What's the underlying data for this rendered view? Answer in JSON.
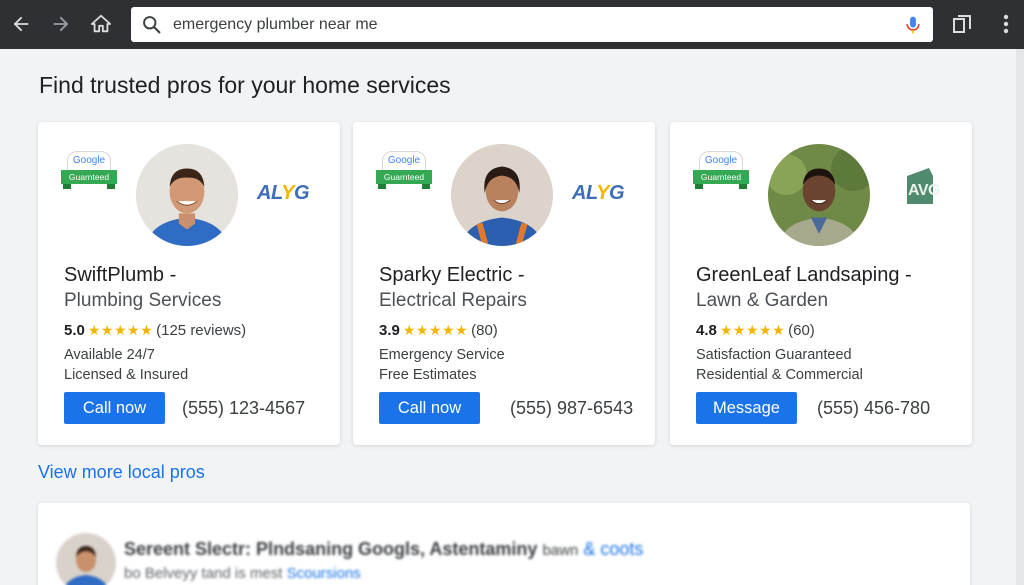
{
  "browser": {
    "search_query": "emergency plumber near me"
  },
  "heading": "Find trusted pros for your home services",
  "cards": [
    {
      "badge_top": "Google",
      "badge_bottom": "Guarnteed",
      "brand": "ALYG",
      "name": "SwiftPlumb -",
      "subtitle": "Plumbing Services",
      "rating": "5.0",
      "stars": "★★★★★",
      "reviews": "(125 reviews)",
      "line1": "Available 24/7",
      "line2": "Licensed & Insured",
      "action": "Call now",
      "phone": "(555) 123-4567"
    },
    {
      "badge_top": "Google",
      "badge_bottom": "Guarnteed",
      "brand": "ALYG",
      "name": "Sparky Electric -",
      "subtitle": "Electrical Repairs",
      "rating": "3.9",
      "stars": "★★★★★",
      "reviews": "(80)",
      "line1": "Emergency Service",
      "line2": "Free Estimates",
      "action": "Call now",
      "phone": "(555) 987-6543"
    },
    {
      "badge_top": "Google",
      "badge_bottom": "Guarnteed",
      "brand": "AVG",
      "name": "GreenLeaf Landsaping -",
      "subtitle": "Lawn & Garden",
      "rating": "4.8",
      "stars": "★★★★★",
      "reviews": "(60)",
      "line1": "Satisfaction Guaranteed",
      "line2": "Residential & Commercial",
      "action": "Message",
      "phone": "(555) 456-780"
    }
  ],
  "more_link": "View more local pros",
  "blurred_result": {
    "title": "Sereent Slectr: Plndsaning Googls, Astentaminy",
    "title_tail": "bawn",
    "title_link": "& coots",
    "subtitle": "bo Belveyy tand is mest",
    "subtitle_link": "Scoursions"
  },
  "colors": {
    "toolbar": "#2f3033",
    "accent_blue": "#1a73e8",
    "star_gold": "#f4b400",
    "badge_green": "#34a853"
  },
  "icons": [
    "back-arrow-icon",
    "forward-arrow-icon",
    "home-icon",
    "search-icon",
    "microphone-icon",
    "tab-switcher-icon",
    "menu-dots-icon",
    "star-icon"
  ]
}
